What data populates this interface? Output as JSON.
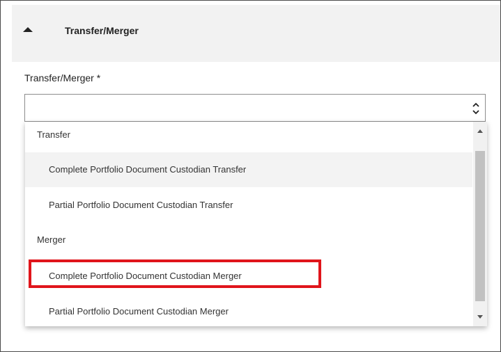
{
  "section": {
    "title": "Transfer/Merger",
    "toggle_icon": "chevron-up-icon"
  },
  "field": {
    "label": "Transfer/Merger *",
    "value": "",
    "arrows_icon": "up-down-chevron-icon"
  },
  "dropdown": {
    "groups": [
      {
        "label": "Transfer",
        "options": [
          "Complete Portfolio Document Custodian Transfer",
          "Partial Portfolio Document Custodian Transfer"
        ]
      },
      {
        "label": "Merger",
        "options": [
          "Complete Portfolio Document Custodian Merger",
          "Partial Portfolio Document Custodian Merger"
        ]
      }
    ],
    "hovered_option": "Complete Portfolio Document Custodian Transfer",
    "highlighted_option": "Complete Portfolio Document Custodian Merger"
  },
  "colors": {
    "header_bg": "#f2f2f2",
    "hover_bg": "#f3f3f3",
    "highlight": "#e0151b",
    "scroll_thumb": "#c1c1c1"
  }
}
